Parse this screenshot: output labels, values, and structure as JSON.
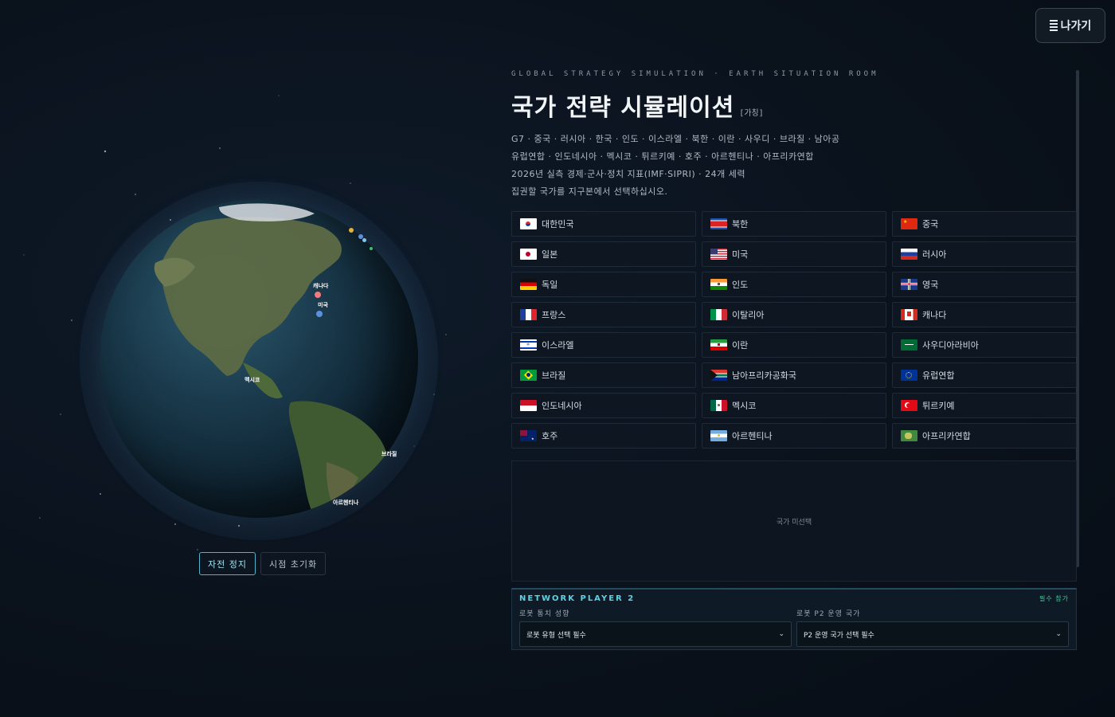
{
  "header": {
    "exit_label": "나가기"
  },
  "globe": {
    "markers": [
      {
        "label": "캐나다",
        "color": "#f27a7a"
      },
      {
        "label": "미국",
        "color": "#5b8fe0"
      },
      {
        "label": "멕시코",
        "color": ""
      },
      {
        "label": "브라질",
        "color": "#35c46a"
      },
      {
        "label": "아르헨티나",
        "color": "#7cc8f0"
      }
    ],
    "controls": {
      "rotate_label": "자전 정지",
      "reset_label": "시점 초기화"
    }
  },
  "intro": {
    "kicker": "GLOBAL STRATEGY SIMULATION · EARTH SITUATION ROOM",
    "title": "국가 전략 시뮬레이션",
    "tag": "[가칭]",
    "line1": "G7 · 중국 · 러시아 · 한국 · 인도 · 이스라엘 · 북한 · 이란 · 사우디 · 브라질 · 남아공",
    "line2": "유럽연합 · 인도네시아 · 멕시코 · 튀르키예 · 호주 · 아르헨티나 · 아프리카연합",
    "line3": "2026년 실측 경제·군사·정치 지표(IMF·SIPRI) · 24개 세력",
    "line4": "집권할 국가를 지구본에서 선택하십시오."
  },
  "countries": [
    {
      "name": "대한민국",
      "flag": "kr"
    },
    {
      "name": "북한",
      "flag": "kp"
    },
    {
      "name": "중국",
      "flag": "cn"
    },
    {
      "name": "일본",
      "flag": "jp"
    },
    {
      "name": "미국",
      "flag": "us"
    },
    {
      "name": "러시아",
      "flag": "ru"
    },
    {
      "name": "독일",
      "flag": "de"
    },
    {
      "name": "인도",
      "flag": "in"
    },
    {
      "name": "영국",
      "flag": "gb"
    },
    {
      "name": "프랑스",
      "flag": "fr"
    },
    {
      "name": "이탈리아",
      "flag": "it"
    },
    {
      "name": "캐나다",
      "flag": "ca"
    },
    {
      "name": "이스라엘",
      "flag": "il"
    },
    {
      "name": "이란",
      "flag": "ir"
    },
    {
      "name": "사우디아라비아",
      "flag": "sa"
    },
    {
      "name": "브라질",
      "flag": "br"
    },
    {
      "name": "남아프리카공화국",
      "flag": "za"
    },
    {
      "name": "유럽연합",
      "flag": "eu"
    },
    {
      "name": "인도네시아",
      "flag": "id"
    },
    {
      "name": "멕시코",
      "flag": "mx"
    },
    {
      "name": "튀르키예",
      "flag": "tr"
    },
    {
      "name": "호주",
      "flag": "au"
    },
    {
      "name": "아르헨티나",
      "flag": "ar"
    },
    {
      "name": "아프리카연합",
      "flag": "au-union"
    }
  ],
  "detail": {
    "placeholder": "국가 미선택"
  },
  "network": {
    "title": "NETWORK PLAYER 2",
    "badge": "필수 참가",
    "robot_label": "로봇 통치 성향",
    "robot_value": "로봇 유형 선택 필수",
    "country_label": "로봇 P2 운영 국가",
    "country_value": "P2 운영 국가 선택 필수"
  }
}
